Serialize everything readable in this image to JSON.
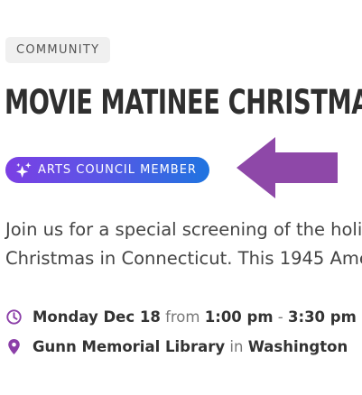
{
  "event": {
    "category": "COMMUNITY",
    "title": "MOVIE MATINEE CHRISTMAS IN",
    "badge_label": "ARTS COUNCIL MEMBER",
    "description_line1": "Join us for a special screening of the holi",
    "description_line2": "Christmas in Connecticut. This 1945 Ame",
    "date": {
      "day": "Monday Dec 18",
      "from_word": "from",
      "start_time": "1:00 pm",
      "dash": "-",
      "end_time": "3:30 pm"
    },
    "location": {
      "venue": "Gunn Memorial Library",
      "in_word": "in",
      "town": "Washington"
    }
  },
  "icons": {
    "badge": "sparkle-icon",
    "callout": "arrow-left-icon",
    "date": "clock-icon",
    "location": "map-pin-icon"
  },
  "colors": {
    "accent_purple": "#8b3fa8",
    "badge_gradient_start": "#7b3fe4",
    "badge_gradient_end": "#1f74e0",
    "arrow": "#8e48a8",
    "title": "#2f2f2f",
    "body_text": "#444444"
  }
}
